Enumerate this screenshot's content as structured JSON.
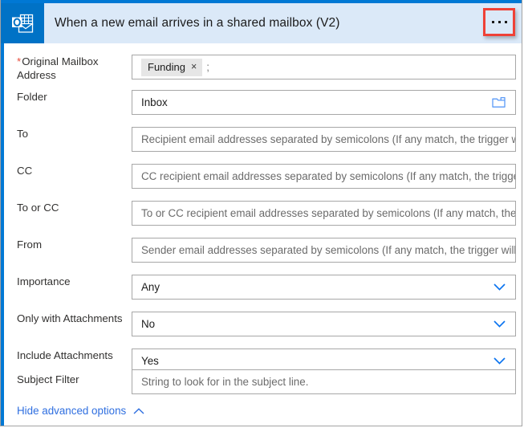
{
  "header": {
    "title": "When a new email arrives in a shared mailbox (V2)",
    "app_icon": "outlook-icon",
    "menu_label": "...",
    "menu_icon": "ellipsis-icon",
    "accent_color": "#0078d4",
    "band_color": "#dbe9f8",
    "icon_tile_color": "#0072c6",
    "highlight_color": "#ef4136"
  },
  "fields": [
    {
      "label": "Original Mailbox Address",
      "required": true,
      "required_marker": "*",
      "type": "token",
      "token": "Funding",
      "token_remove": "×",
      "separator": ";"
    },
    {
      "label": "Folder",
      "required": false,
      "type": "picker",
      "value": "Inbox",
      "icon": "folder-icon"
    },
    {
      "label": "To",
      "required": false,
      "type": "text",
      "placeholder": "Recipient email addresses separated by semicolons (If any match, the trigger will fire.)"
    },
    {
      "label": "CC",
      "required": false,
      "type": "text",
      "placeholder": "CC recipient email addresses separated by semicolons (If any match, the trigger will fire.)"
    },
    {
      "label": "To or CC",
      "required": false,
      "type": "text",
      "placeholder": "To or CC recipient email addresses separated by semicolons (If any match, the trigger will fire.)"
    },
    {
      "label": "From",
      "required": false,
      "type": "text",
      "placeholder": "Sender email addresses separated by semicolons (If any match, the trigger will fire.)"
    },
    {
      "label": "Importance",
      "required": false,
      "type": "select",
      "value": "Any",
      "icon": "chevron-down-icon"
    },
    {
      "label": "Only with Attachments",
      "required": false,
      "type": "select",
      "value": "No",
      "icon": "chevron-down-icon"
    },
    {
      "label": "Include Attachments",
      "required": false,
      "type": "select",
      "value": "Yes",
      "icon": "chevron-down-icon"
    },
    {
      "label": "Subject Filter",
      "required": false,
      "type": "text",
      "placeholder": "String to look for in the subject line."
    }
  ],
  "footer": {
    "advanced_link": "Hide advanced options",
    "advanced_icon": "chevron-up-icon",
    "link_color": "#2f6fe0"
  }
}
